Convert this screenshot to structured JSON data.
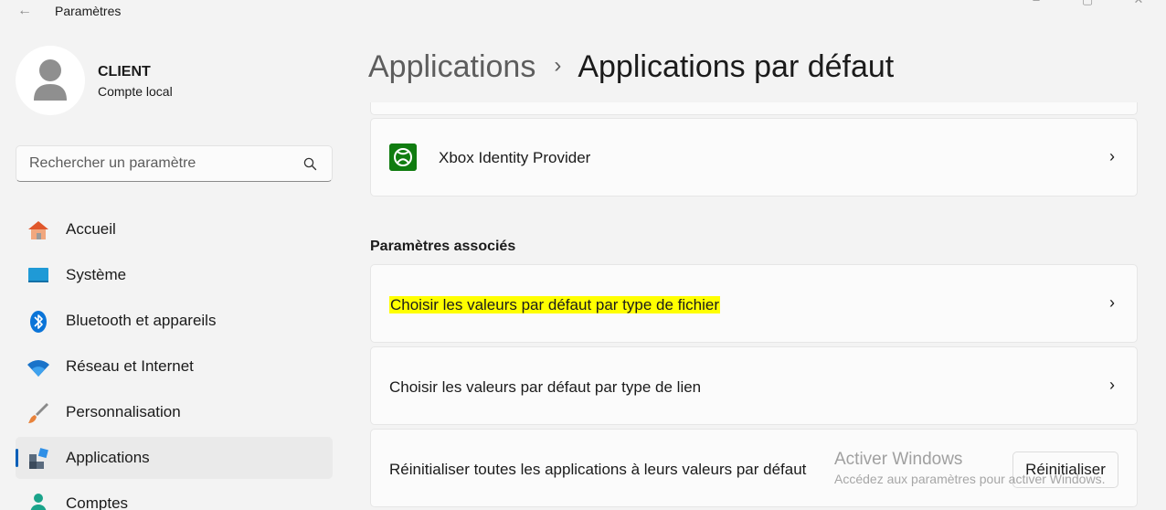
{
  "window": {
    "title": "Paramètres",
    "back_glyph": "←",
    "controls": {
      "minimize": "–",
      "maximize": "▢",
      "close": "✕"
    }
  },
  "profile": {
    "name": "CLIENT",
    "account_type": "Compte local"
  },
  "search": {
    "placeholder": "Rechercher un paramètre"
  },
  "sidebar": {
    "items": [
      {
        "label": "Accueil",
        "icon": "home-icon",
        "active": false
      },
      {
        "label": "Système",
        "icon": "system-icon",
        "active": false
      },
      {
        "label": "Bluetooth et appareils",
        "icon": "bluetooth-icon",
        "active": false
      },
      {
        "label": "Réseau et Internet",
        "icon": "wifi-icon",
        "active": false
      },
      {
        "label": "Personnalisation",
        "icon": "brush-icon",
        "active": false
      },
      {
        "label": "Applications",
        "icon": "apps-icon",
        "active": true
      },
      {
        "label": "Comptes",
        "icon": "accounts-icon",
        "active": false
      }
    ]
  },
  "header": {
    "parent": "Applications",
    "separator": "›",
    "current": "Applications par défaut"
  },
  "main": {
    "app_item": {
      "label": "Xbox Identity Provider",
      "icon": "xbox-icon"
    },
    "related_title": "Paramètres associés",
    "related_items": [
      {
        "label": "Choisir les valeurs par défaut par type de fichier",
        "highlighted": true
      },
      {
        "label": "Choisir les valeurs par défaut par type de lien",
        "highlighted": false
      }
    ],
    "reset": {
      "label": "Réinitialiser toutes les applications à leurs valeurs par défaut",
      "button": "Réinitialiser"
    },
    "chevron": "›"
  },
  "watermark": {
    "title": "Activer Windows",
    "subtitle": "Accédez aux paramètres pour activer Windows."
  },
  "colors": {
    "accent": "#005fb8",
    "highlight": "#ffff00",
    "xbox_green": "#107c10",
    "background": "#f3f3f3"
  }
}
